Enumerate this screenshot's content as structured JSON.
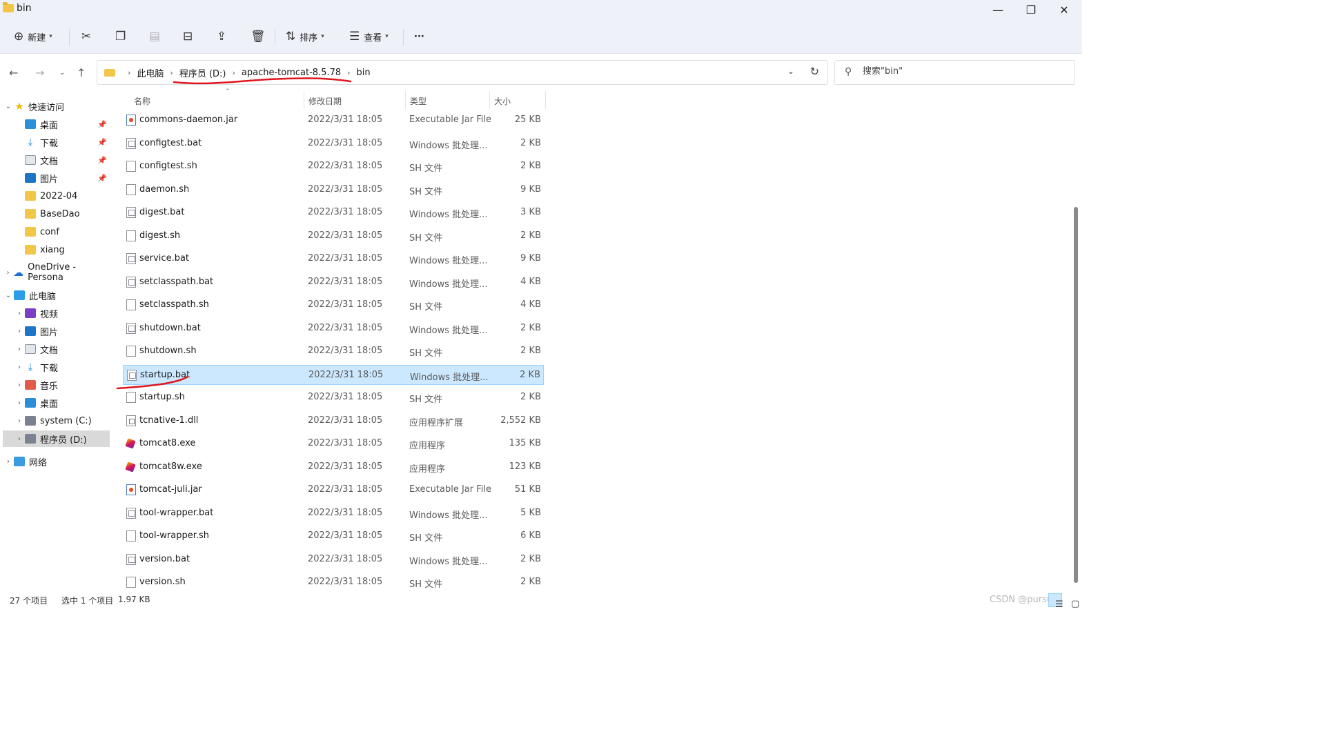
{
  "window": {
    "title": "bin",
    "minimize_icon": "—",
    "maximize_icon": "❐",
    "close_icon": "✕"
  },
  "toolbar": {
    "new_label": "新建",
    "sort_label": "排序",
    "view_label": "查看",
    "more_label": "···"
  },
  "address": {
    "crumbs": [
      "此电脑",
      "程序员 (D:)",
      "apache-tomcat-8.5.78",
      "bin"
    ]
  },
  "search": {
    "placeholder": "搜索\"bin\""
  },
  "sidebar": {
    "quick_access": "快速访问",
    "quick_items": [
      "桌面",
      "下载",
      "文档",
      "图片",
      "2022-04",
      "BaseDao",
      "conf",
      "xiang"
    ],
    "onedrive": "OneDrive - Persona",
    "this_pc": "此电脑",
    "pc_items": [
      "视频",
      "图片",
      "文档",
      "下载",
      "音乐",
      "桌面",
      "system (C:)",
      "程序员 (D:)"
    ],
    "network": "网络"
  },
  "columns": {
    "name": "名称",
    "date": "修改日期",
    "type": "类型",
    "size": "大小"
  },
  "files": [
    {
      "name": "commons-daemon.jar",
      "date": "2022/3/31 18:05",
      "type": "Executable Jar File",
      "size": "25 KB",
      "icon": "jar"
    },
    {
      "name": "configtest.bat",
      "date": "2022/3/31 18:05",
      "type": "Windows 批处理...",
      "size": "2 KB",
      "icon": "bat"
    },
    {
      "name": "configtest.sh",
      "date": "2022/3/31 18:05",
      "type": "SH 文件",
      "size": "2 KB",
      "icon": "sh"
    },
    {
      "name": "daemon.sh",
      "date": "2022/3/31 18:05",
      "type": "SH 文件",
      "size": "9 KB",
      "icon": "sh"
    },
    {
      "name": "digest.bat",
      "date": "2022/3/31 18:05",
      "type": "Windows 批处理...",
      "size": "3 KB",
      "icon": "bat"
    },
    {
      "name": "digest.sh",
      "date": "2022/3/31 18:05",
      "type": "SH 文件",
      "size": "2 KB",
      "icon": "sh"
    },
    {
      "name": "service.bat",
      "date": "2022/3/31 18:05",
      "type": "Windows 批处理...",
      "size": "9 KB",
      "icon": "bat"
    },
    {
      "name": "setclasspath.bat",
      "date": "2022/3/31 18:05",
      "type": "Windows 批处理...",
      "size": "4 KB",
      "icon": "bat"
    },
    {
      "name": "setclasspath.sh",
      "date": "2022/3/31 18:05",
      "type": "SH 文件",
      "size": "4 KB",
      "icon": "sh"
    },
    {
      "name": "shutdown.bat",
      "date": "2022/3/31 18:05",
      "type": "Windows 批处理...",
      "size": "2 KB",
      "icon": "bat"
    },
    {
      "name": "shutdown.sh",
      "date": "2022/3/31 18:05",
      "type": "SH 文件",
      "size": "2 KB",
      "icon": "sh"
    },
    {
      "name": "startup.bat",
      "date": "2022/3/31 18:05",
      "type": "Windows 批处理...",
      "size": "2 KB",
      "icon": "bat",
      "selected": true
    },
    {
      "name": "startup.sh",
      "date": "2022/3/31 18:05",
      "type": "SH 文件",
      "size": "2 KB",
      "icon": "sh"
    },
    {
      "name": "tcnative-1.dll",
      "date": "2022/3/31 18:05",
      "type": "应用程序扩展",
      "size": "2,552 KB",
      "icon": "dll"
    },
    {
      "name": "tomcat8.exe",
      "date": "2022/3/31 18:05",
      "type": "应用程序",
      "size": "135 KB",
      "icon": "exe"
    },
    {
      "name": "tomcat8w.exe",
      "date": "2022/3/31 18:05",
      "type": "应用程序",
      "size": "123 KB",
      "icon": "exe"
    },
    {
      "name": "tomcat-juli.jar",
      "date": "2022/3/31 18:05",
      "type": "Executable Jar File",
      "size": "51 KB",
      "icon": "jar"
    },
    {
      "name": "tool-wrapper.bat",
      "date": "2022/3/31 18:05",
      "type": "Windows 批处理...",
      "size": "5 KB",
      "icon": "bat"
    },
    {
      "name": "tool-wrapper.sh",
      "date": "2022/3/31 18:05",
      "type": "SH 文件",
      "size": "6 KB",
      "icon": "sh"
    },
    {
      "name": "version.bat",
      "date": "2022/3/31 18:05",
      "type": "Windows 批处理...",
      "size": "2 KB",
      "icon": "bat"
    },
    {
      "name": "version.sh",
      "date": "2022/3/31 18:05",
      "type": "SH 文件",
      "size": "2 KB",
      "icon": "sh"
    }
  ],
  "status": {
    "count": "27 个项目",
    "selected": "选中 1 个项目",
    "size": "1.97 KB"
  },
  "watermark": "CSDN @pursu",
  "colors": {
    "selection_bg": "#cce8ff",
    "selection_border": "#99d1ff",
    "annotation_red": "#e0141c"
  }
}
